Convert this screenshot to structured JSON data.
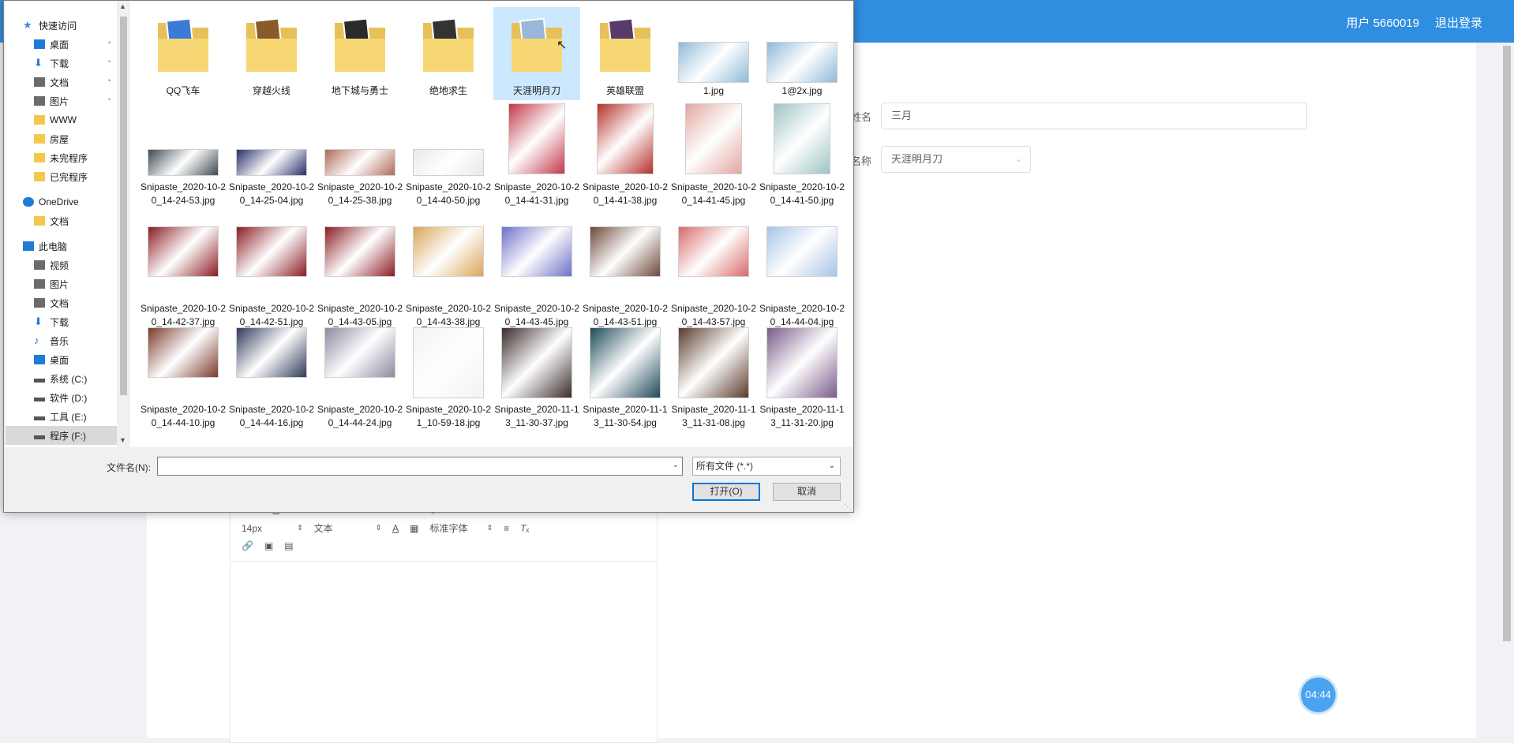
{
  "app": {
    "header": {
      "user": "用户 5660019",
      "logout": "退出登录"
    },
    "form": {
      "name_label": "姓名",
      "name_value": "三月",
      "title_label": "名称",
      "title_value": "天涯明月刀"
    },
    "editor": {
      "font_size": "14px",
      "text_type": "文本",
      "font_family": "标准字体"
    },
    "timer": "04:44"
  },
  "dialog": {
    "nav": [
      {
        "label": "快速访问",
        "icon": "star-icon",
        "pinned": false,
        "color": "#3c8be0"
      },
      {
        "label": "桌面",
        "icon": "desktop-icon",
        "pinned": true,
        "color": "#1e7bd6"
      },
      {
        "label": "下载",
        "icon": "download-icon",
        "pinned": true,
        "color": "#1e7bd6"
      },
      {
        "label": "文档",
        "icon": "document-icon",
        "pinned": true,
        "color": "#6b6b6b"
      },
      {
        "label": "图片",
        "icon": "picture-icon",
        "pinned": true,
        "color": "#6b6b6b"
      },
      {
        "label": "WWW",
        "icon": "folder-icon",
        "pinned": false,
        "color": "#f5c84c"
      },
      {
        "label": "房屋",
        "icon": "folder-icon",
        "pinned": false,
        "color": "#f5c84c"
      },
      {
        "label": "未完程序",
        "icon": "folder-icon",
        "pinned": false,
        "color": "#f5c84c"
      },
      {
        "label": "已完程序",
        "icon": "folder-icon",
        "pinned": false,
        "color": "#f5c84c"
      },
      {
        "label": "OneDrive",
        "icon": "cloud-icon",
        "pinned": false,
        "color": "#1e7bd6"
      },
      {
        "label": "文档",
        "icon": "folder-icon",
        "pinned": false,
        "color": "#f5c84c"
      },
      {
        "label": "此电脑",
        "icon": "computer-icon",
        "pinned": false,
        "color": "#1e7bd6"
      },
      {
        "label": "视频",
        "icon": "video-icon",
        "pinned": false,
        "color": "#6b6b6b"
      },
      {
        "label": "图片",
        "icon": "picture-icon",
        "pinned": false,
        "color": "#6b6b6b"
      },
      {
        "label": "文档",
        "icon": "document-icon",
        "pinned": false,
        "color": "#6b6b6b"
      },
      {
        "label": "下载",
        "icon": "download-icon",
        "pinned": false,
        "color": "#1e7bd6"
      },
      {
        "label": "音乐",
        "icon": "music-icon",
        "pinned": false,
        "color": "#1e7bd6"
      },
      {
        "label": "桌面",
        "icon": "desktop-icon",
        "pinned": false,
        "color": "#1e7bd6"
      },
      {
        "label": "系统 (C:)",
        "icon": "drive-icon",
        "pinned": false,
        "color": "#555"
      },
      {
        "label": "软件 (D:)",
        "icon": "drive-icon",
        "pinned": false,
        "color": "#555"
      },
      {
        "label": "工具 (E:)",
        "icon": "drive-icon",
        "pinned": false,
        "color": "#555"
      },
      {
        "label": "程序 (F:)",
        "icon": "drive-icon",
        "pinned": false,
        "color": "#555"
      }
    ],
    "files": [
      {
        "name": "QQ飞车",
        "kind": "folder",
        "color": "#3a7bd5"
      },
      {
        "name": "穿越火线",
        "kind": "folder",
        "color": "#8a5a2b"
      },
      {
        "name": "地下城与勇士",
        "kind": "folder",
        "color": "#2a2a2a"
      },
      {
        "name": "绝地求生",
        "kind": "folder",
        "color": "#333333"
      },
      {
        "name": "天涯明月刀",
        "kind": "folder",
        "color": "#9ab7d9"
      },
      {
        "name": "英雄联盟",
        "kind": "folder",
        "color": "#5a3a6a"
      },
      {
        "name": "1.jpg",
        "kind": "wide",
        "color": "#8fb9d8"
      },
      {
        "name": "1@2x.jpg",
        "kind": "wide",
        "color": "#8fb9d8"
      },
      {
        "name": "Snipaste_2020-10-20_14-24-53.jpg",
        "kind": "banner",
        "color": "#3d4a55"
      },
      {
        "name": "Snipaste_2020-10-20_14-25-04.jpg",
        "kind": "banner",
        "color": "#28306a"
      },
      {
        "name": "Snipaste_2020-10-20_14-25-38.jpg",
        "kind": "banner",
        "color": "#b06a5a"
      },
      {
        "name": "Snipaste_2020-10-20_14-40-50.jpg",
        "kind": "banner",
        "color": "#e9e9e9"
      },
      {
        "name": "Snipaste_2020-10-20_14-41-31.jpg",
        "kind": "poster",
        "color": "#c2384a"
      },
      {
        "name": "Snipaste_2020-10-20_14-41-38.jpg",
        "kind": "poster",
        "color": "#b5302a"
      },
      {
        "name": "Snipaste_2020-10-20_14-41-45.jpg",
        "kind": "poster",
        "color": "#e2a7a0"
      },
      {
        "name": "Snipaste_2020-10-20_14-41-50.jpg",
        "kind": "poster",
        "color": "#9fc3c4"
      },
      {
        "name": "Snipaste_2020-10-20_14-42-37.jpg",
        "kind": "card",
        "color": "#8a1d23"
      },
      {
        "name": "Snipaste_2020-10-20_14-42-51.jpg",
        "kind": "card",
        "color": "#8a1d23"
      },
      {
        "name": "Snipaste_2020-10-20_14-43-05.jpg",
        "kind": "card",
        "color": "#8a1d23"
      },
      {
        "name": "Snipaste_2020-10-20_14-43-38.jpg",
        "kind": "card",
        "color": "#d9a65a"
      },
      {
        "name": "Snipaste_2020-10-20_14-43-45.jpg",
        "kind": "card",
        "color": "#6d70c9"
      },
      {
        "name": "Snipaste_2020-10-20_14-43-51.jpg",
        "kind": "card",
        "color": "#6a4a3a"
      },
      {
        "name": "Snipaste_2020-10-20_14-43-57.jpg",
        "kind": "card",
        "color": "#d96a6a"
      },
      {
        "name": "Snipaste_2020-10-20_14-44-04.jpg",
        "kind": "card",
        "color": "#a7c3e6"
      },
      {
        "name": "Snipaste_2020-10-20_14-44-10.jpg",
        "kind": "card",
        "color": "#7a3a2a"
      },
      {
        "name": "Snipaste_2020-10-20_14-44-16.jpg",
        "kind": "card",
        "color": "#2e3a5a"
      },
      {
        "name": "Snipaste_2020-10-20_14-44-24.jpg",
        "kind": "card",
        "color": "#8a8aa0"
      },
      {
        "name": "Snipaste_2020-10-21_10-59-18.jpg",
        "kind": "tall",
        "color": "#f3f3f6"
      },
      {
        "name": "Snipaste_2020-11-13_11-30-37.jpg",
        "kind": "tall",
        "color": "#3a2a2a"
      },
      {
        "name": "Snipaste_2020-11-13_11-30-54.jpg",
        "kind": "tall",
        "color": "#1e4a5a"
      },
      {
        "name": "Snipaste_2020-11-13_11-31-08.jpg",
        "kind": "tall",
        "color": "#5a3a2a"
      },
      {
        "name": "Snipaste_2020-11-13_11-31-20.jpg",
        "kind": "tall",
        "color": "#7a5a8a"
      }
    ],
    "filename_label": "文件名(N):",
    "filename_value": "",
    "filetype": "所有文件 (*.*)",
    "open_button": "打开(O)",
    "cancel_button": "取消"
  }
}
